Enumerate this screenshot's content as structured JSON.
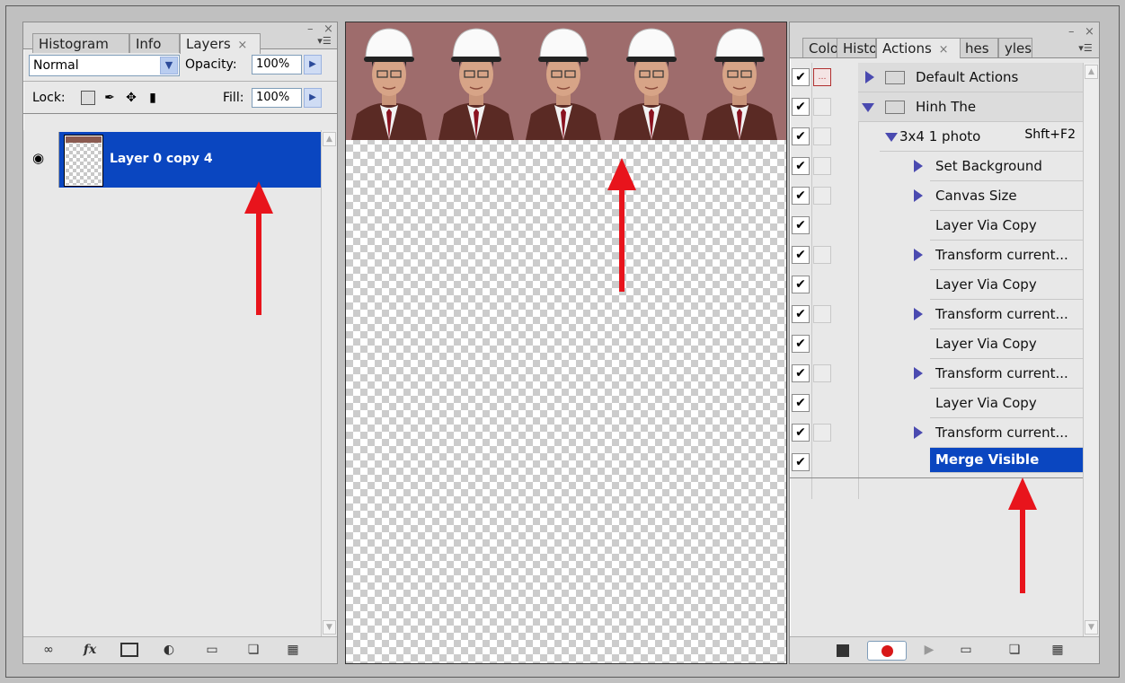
{
  "layers_panel": {
    "tabs": [
      {
        "label": "Histogram",
        "active": false
      },
      {
        "label": "Info",
        "active": false
      },
      {
        "label": "Layers",
        "active": true
      }
    ],
    "close_glyph": "×",
    "window_min": "–",
    "window_close": "×",
    "menu_glyph": "▾☰",
    "blend_mode": "Normal",
    "opacity_label": "Opacity:",
    "opacity_value": "100%",
    "lock_label": "Lock:",
    "fill_label": "Fill:",
    "fill_value": "100%",
    "layers": [
      {
        "name": "Layer 0 copy 4",
        "visible": true,
        "selected": true
      }
    ],
    "bottom_icons": [
      "link-icon",
      "fx-icon",
      "mask-icon",
      "adjustment-icon",
      "group-icon",
      "new-layer-icon",
      "trash-icon"
    ],
    "fx_label": "fx"
  },
  "canvas": {
    "photo_count": 5,
    "background_color": "#9e6c6c"
  },
  "actions_panel": {
    "tabs": [
      {
        "label": "Colo",
        "active": false
      },
      {
        "label": "Histo",
        "active": false
      },
      {
        "label": "Actions",
        "active": true
      },
      {
        "label": "hes",
        "active": false
      },
      {
        "label": "yles",
        "active": false
      }
    ],
    "close_glyph": "×",
    "window_min": "–",
    "window_close": "×",
    "menu_glyph": "▾☰",
    "rows": [
      {
        "label": "Default Actions",
        "checked": true,
        "dialog": "red",
        "indent": 0,
        "type": "set",
        "expanded": false
      },
      {
        "label": "Hinh The",
        "checked": true,
        "dialog": "empty",
        "indent": 0,
        "type": "set",
        "expanded": true
      },
      {
        "label": "3x4 1 photo",
        "shortcut": "Shft+F2",
        "checked": true,
        "dialog": "empty",
        "indent": 1,
        "type": "action",
        "expanded": true
      },
      {
        "label": "Set Background",
        "checked": true,
        "dialog": "empty",
        "indent": 2,
        "type": "step",
        "expandable": true
      },
      {
        "label": "Canvas Size",
        "checked": true,
        "dialog": "empty",
        "indent": 2,
        "type": "step",
        "expandable": true
      },
      {
        "label": "Layer Via Copy",
        "checked": true,
        "dialog": "none",
        "indent": 2,
        "type": "step",
        "expandable": false
      },
      {
        "label": "Transform current...",
        "checked": true,
        "dialog": "empty",
        "indent": 2,
        "type": "step",
        "expandable": true
      },
      {
        "label": "Layer Via Copy",
        "checked": true,
        "dialog": "none",
        "indent": 2,
        "type": "step",
        "expandable": false
      },
      {
        "label": "Transform current...",
        "checked": true,
        "dialog": "empty",
        "indent": 2,
        "type": "step",
        "expandable": true
      },
      {
        "label": "Layer Via Copy",
        "checked": true,
        "dialog": "none",
        "indent": 2,
        "type": "step",
        "expandable": false
      },
      {
        "label": "Transform current...",
        "checked": true,
        "dialog": "empty",
        "indent": 2,
        "type": "step",
        "expandable": true
      },
      {
        "label": "Layer Via Copy",
        "checked": true,
        "dialog": "none",
        "indent": 2,
        "type": "step",
        "expandable": false
      },
      {
        "label": "Transform current...",
        "checked": true,
        "dialog": "empty",
        "indent": 2,
        "type": "step",
        "expandable": true
      },
      {
        "label": "Merge Visible",
        "checked": true,
        "dialog": "none",
        "indent": 2,
        "type": "step",
        "expandable": false,
        "selected": true
      }
    ],
    "bottom_icons": [
      "stop-icon",
      "record-icon",
      "play-icon",
      "new-set-icon",
      "new-action-icon",
      "trash-icon"
    ]
  },
  "colors": {
    "selection": "#0a46c0",
    "arrow": "#e8141c",
    "panel_bg": "#e8e8e8"
  }
}
